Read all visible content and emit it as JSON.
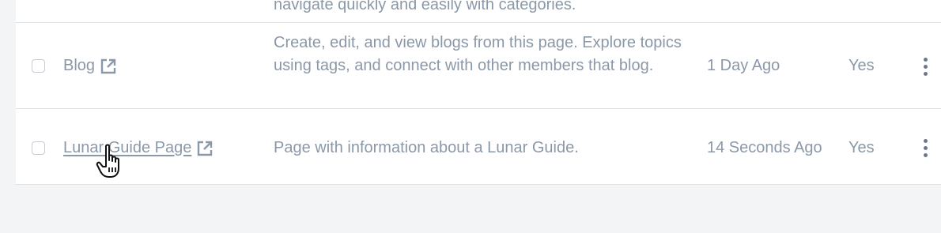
{
  "rows": [
    {
      "description": "navigate quickly and easily with categories."
    },
    {
      "title": "Blog",
      "description": "Create, edit, and view blogs from this page. Explore topics using tags, and connect with other members that blog.",
      "modified": "1 Day Ago",
      "active": "Yes"
    },
    {
      "title": "Lunar Guide Page",
      "description": "Page with information about a Lunar Guide.",
      "modified": "14 Seconds Ago",
      "active": "Yes"
    }
  ],
  "icons": {
    "external_link": "external-link-icon",
    "more_actions": "vertical-ellipsis-icon",
    "cursor": "hand-pointer-cursor"
  },
  "colors": {
    "text": "#8b98a8",
    "border": "#dfe3e8",
    "page_background": "#f2f4f6",
    "kebab": "#6b7888"
  }
}
